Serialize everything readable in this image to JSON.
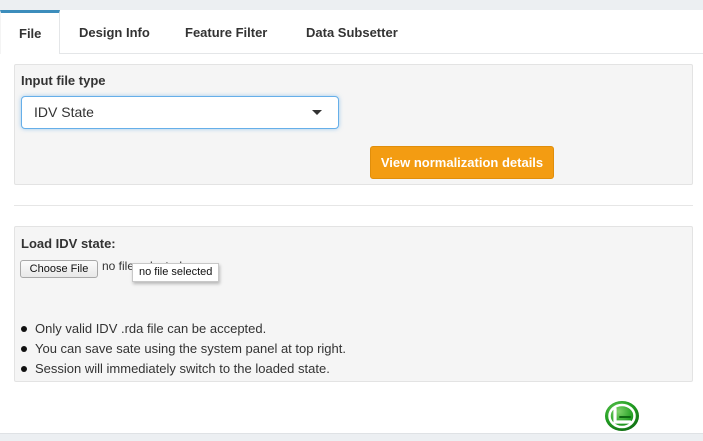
{
  "tabs": [
    {
      "label": "File",
      "active": true
    },
    {
      "label": "Design Info",
      "active": false
    },
    {
      "label": "Feature Filter",
      "active": false
    },
    {
      "label": "Data Subsetter",
      "active": false
    }
  ],
  "input_file_type": {
    "label": "Input file type",
    "selected": "IDV State"
  },
  "normalization_button": {
    "label": "View normalization details",
    "color": "#f39c12"
  },
  "load_state": {
    "label": "Load IDV state:",
    "choose_file_label": "Choose File",
    "file_status": "no file selected",
    "tooltip": "no file selected"
  },
  "notes": [
    "Only valid IDV .rda file can be accepted.",
    "You can save sate using the system panel at top right.",
    "Session will immediately switch to the loaded state."
  ],
  "colors": {
    "accent": "#3c8dbc",
    "logo_green": "#1f9a1f"
  }
}
